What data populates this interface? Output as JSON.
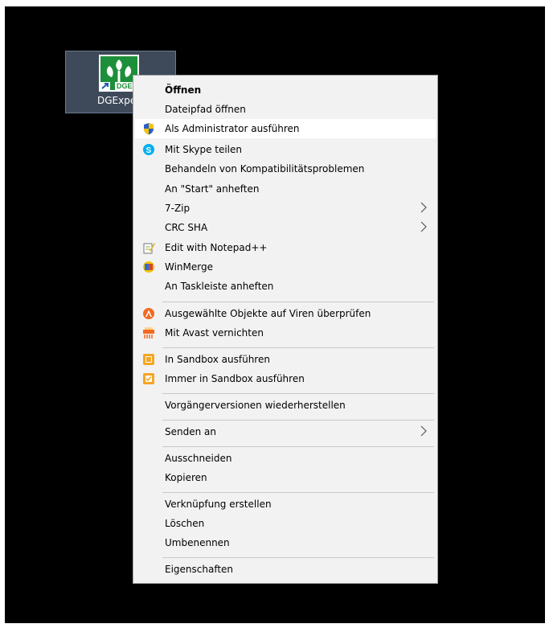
{
  "desktop": {
    "icon_label": "DGExpe"
  },
  "menu": {
    "items": [
      {
        "label": "Öffnen",
        "bold": true,
        "icon": ""
      },
      {
        "label": "Dateipfad öffnen",
        "icon": ""
      },
      {
        "label": "Als Administrator ausführen",
        "icon": "uac-shield-icon",
        "highlighted": true
      },
      {
        "label": "Mit Skype teilen",
        "icon": "skype-icon"
      },
      {
        "label": "Behandeln von Kompatibilitätsproblemen",
        "icon": ""
      },
      {
        "label": "An \"Start\" anheften",
        "icon": ""
      },
      {
        "label": "7-Zip",
        "icon": "",
        "submenu": true
      },
      {
        "label": "CRC SHA",
        "icon": "",
        "submenu": true
      },
      {
        "label": "Edit with Notepad++",
        "icon": "notepadpp-icon"
      },
      {
        "label": "WinMerge",
        "icon": "winmerge-icon"
      },
      {
        "label": "An Taskleiste anheften",
        "icon": ""
      },
      {
        "label": "Ausgewählte Objekte auf Viren überprüfen",
        "icon": "avast-icon"
      },
      {
        "label": "Mit Avast vernichten",
        "icon": "shredder-icon"
      },
      {
        "label": "In Sandbox ausführen",
        "icon": "sandbox-icon"
      },
      {
        "label": "Immer in Sandbox ausführen",
        "icon": "sandbox-check-icon"
      },
      {
        "label": "Vorgängerversionen wiederherstellen",
        "icon": ""
      },
      {
        "label": "Senden an",
        "icon": "",
        "submenu": true
      },
      {
        "label": "Ausschneiden",
        "icon": ""
      },
      {
        "label": "Kopieren",
        "icon": ""
      },
      {
        "label": "Verknüpfung erstellen",
        "icon": ""
      },
      {
        "label": "Löschen",
        "icon": ""
      },
      {
        "label": "Umbenennen",
        "icon": ""
      },
      {
        "label": "Eigenschaften",
        "icon": ""
      }
    ]
  },
  "colors": {
    "desktop_bg": "#000000",
    "menu_bg": "#f2f2f2",
    "highlight": "#ffffff",
    "avast_orange": "#f26a21",
    "skype_blue": "#00aff0"
  }
}
